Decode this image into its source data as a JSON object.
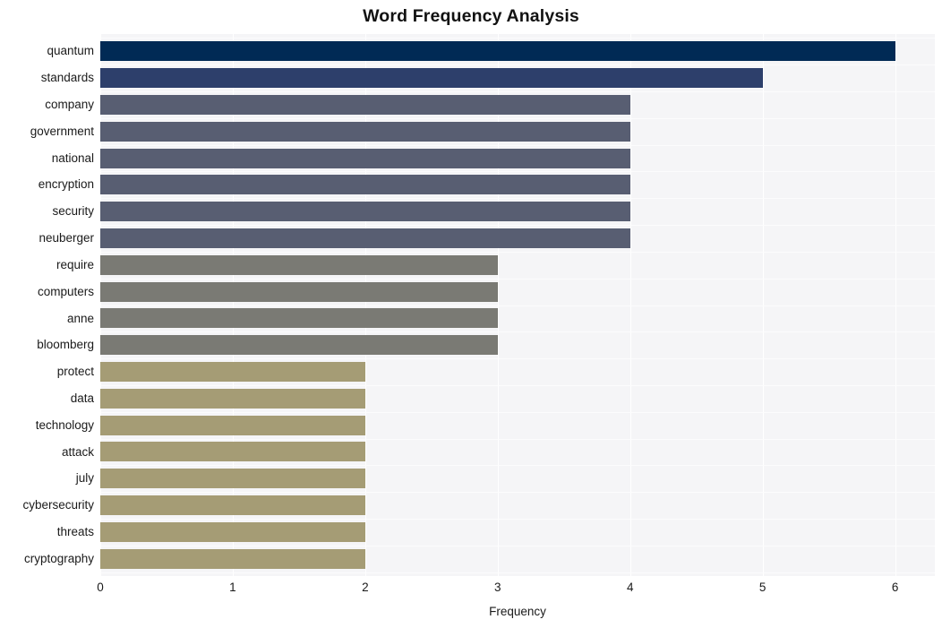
{
  "chart_data": {
    "type": "bar",
    "orientation": "horizontal",
    "title": "Word Frequency Analysis",
    "xlabel": "Frequency",
    "ylabel": "",
    "categories": [
      "quantum",
      "standards",
      "company",
      "government",
      "national",
      "encryption",
      "security",
      "neuberger",
      "require",
      "computers",
      "anne",
      "bloomberg",
      "protect",
      "data",
      "technology",
      "attack",
      "july",
      "cybersecurity",
      "threats",
      "cryptography"
    ],
    "values": [
      6,
      5,
      4,
      4,
      4,
      4,
      4,
      4,
      3,
      3,
      3,
      3,
      2,
      2,
      2,
      2,
      2,
      2,
      2,
      2
    ],
    "bar_colors": [
      "#012a55",
      "#2d3f6b",
      "#585e72",
      "#585e72",
      "#585e72",
      "#585e72",
      "#585e72",
      "#585e72",
      "#7a7a74",
      "#7a7a74",
      "#7a7a74",
      "#7a7a74",
      "#a59c75",
      "#a59c75",
      "#a59c75",
      "#a59c75",
      "#a59c75",
      "#a59c75",
      "#a59c75",
      "#a59c75"
    ],
    "xlim": [
      0,
      6.3
    ],
    "xticks": [
      "0",
      "1",
      "2",
      "3",
      "4",
      "5",
      "6"
    ],
    "xtick_values": [
      0,
      1,
      2,
      3,
      4,
      5,
      6
    ],
    "grid": true,
    "grid_color": "#ffffff",
    "plot_background": "#f5f5f7",
    "figure_background": "#ffffff",
    "legend": null,
    "legend_position": "none"
  },
  "style": {
    "title_color": "#121212",
    "tick_label_color": "#1a1a1a",
    "axis_label_color": "#1a1a1a"
  }
}
